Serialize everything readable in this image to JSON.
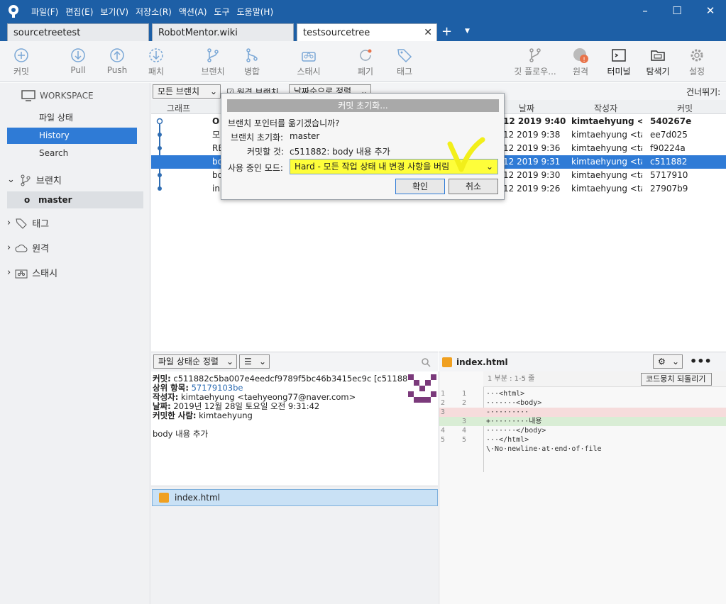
{
  "menu": [
    "파일(F)",
    "편집(E)",
    "보기(V)",
    "저장소(R)",
    "액션(A)",
    "도구",
    "도움말(H)"
  ],
  "tabs": [
    {
      "label": "sourcetreetest"
    },
    {
      "label": "RobotMentor.wiki"
    },
    {
      "label": "testsourcetree"
    }
  ],
  "toolbar": {
    "commit": "커밋",
    "pull": "Pull",
    "push": "Push",
    "patch": "패치",
    "branch": "브랜치",
    "merge": "병합",
    "stash": "스태시",
    "discard": "폐기",
    "tag": "태그",
    "gitflow": "깃 플로우...",
    "remote": "원격",
    "terminal": "터미널",
    "explorer": "탐색기",
    "settings": "설정"
  },
  "sidebar": {
    "workspace": "WORKSPACE",
    "items": [
      "파일 상태",
      "History",
      "Search"
    ],
    "branches": "브랜치",
    "master": "master",
    "tags": "태그",
    "remotes": "원격",
    "stashes": "스태시"
  },
  "filterbar": {
    "branches": "모든 브랜치",
    "remote": "원격 브랜치",
    "order": "날짜순으로 정렬",
    "jump": "건너뛰기:"
  },
  "columns": {
    "graph": "그래프",
    "date": "날짜",
    "author": "작성자",
    "commit": "커밋"
  },
  "commits": [
    {
      "desc": "O",
      "date": "12 2019 9:40",
      "author": "kimtaehyung <ta",
      "hash": "540267e"
    },
    {
      "desc": "모",
      "date": "12 2019 9:38",
      "author": "kimtaehyung <tae",
      "hash": "ee7d025"
    },
    {
      "desc": "RE",
      "date": "12 2019 9:36",
      "author": "kimtaehyung <tae",
      "hash": "f90224a"
    },
    {
      "desc": "bo",
      "date": "12 2019 9:31",
      "author": "kimtaehyung <tae",
      "hash": "c511882"
    },
    {
      "desc": "bo",
      "date": "12 2019 9:30",
      "author": "kimtaehyung <tae",
      "hash": "5717910"
    },
    {
      "desc": "in",
      "date": "12 2019 9:26",
      "author": "kimtaehyung <tae",
      "hash": "27907b9"
    }
  ],
  "bottom": {
    "sort": "파일 상태순 정렬",
    "commit_label": "커밋:",
    "commit_value": "c511882c5ba007e4eedcf9789f5bc46b3415ec9c [c511882]",
    "parent_label": "상위 항목:",
    "parent_value": "57179103be",
    "author_label": "작성자:",
    "author_value": "kimtaehyung <taehyeong77@naver.com>",
    "date_label": "날짜:",
    "date_value": "2019년 12월 28일 토요일 오전 9:31:42",
    "committer_label": "커밋한 사람:",
    "committer_value": "kimtaehyung",
    "message": "body 내용 추가",
    "file": "index.html"
  },
  "diff": {
    "file": "index.html",
    "hunk": "1 부분 : 1-5 줄",
    "revert": "코드뭉치 되돌리기",
    "lines": [
      {
        "n1": "1",
        "n2": "1",
        "code": "···<html>",
        "kind": ""
      },
      {
        "n1": "2",
        "n2": "2",
        "code": "·······<body>",
        "kind": ""
      },
      {
        "n1": "3",
        "n2": "",
        "code": "-·········",
        "kind": "del"
      },
      {
        "n1": "",
        "n2": "3",
        "code": "+·········내용",
        "kind": "add"
      },
      {
        "n1": "4",
        "n2": "4",
        "code": "·······</body>",
        "kind": ""
      },
      {
        "n1": "5",
        "n2": "5",
        "code": "···</html>",
        "kind": ""
      },
      {
        "n1": "",
        "n2": "",
        "code": "\\·No·newline·at·end·of·file",
        "kind": ""
      }
    ]
  },
  "dialog": {
    "title": "커밋 초기화...",
    "question": "브랜치 포인터를 옮기겠습니까?",
    "branch_label": "브랜치 초기화:",
    "branch_value": "master",
    "commit_label": "커밋할 것:",
    "commit_value": "c511882: body 내용 추가",
    "mode_label": "사용 중인 모드:",
    "mode_value": "Hard - 모든 작업 상태 내 변경 사항을 버림",
    "ok": "확인",
    "cancel": "취소"
  }
}
